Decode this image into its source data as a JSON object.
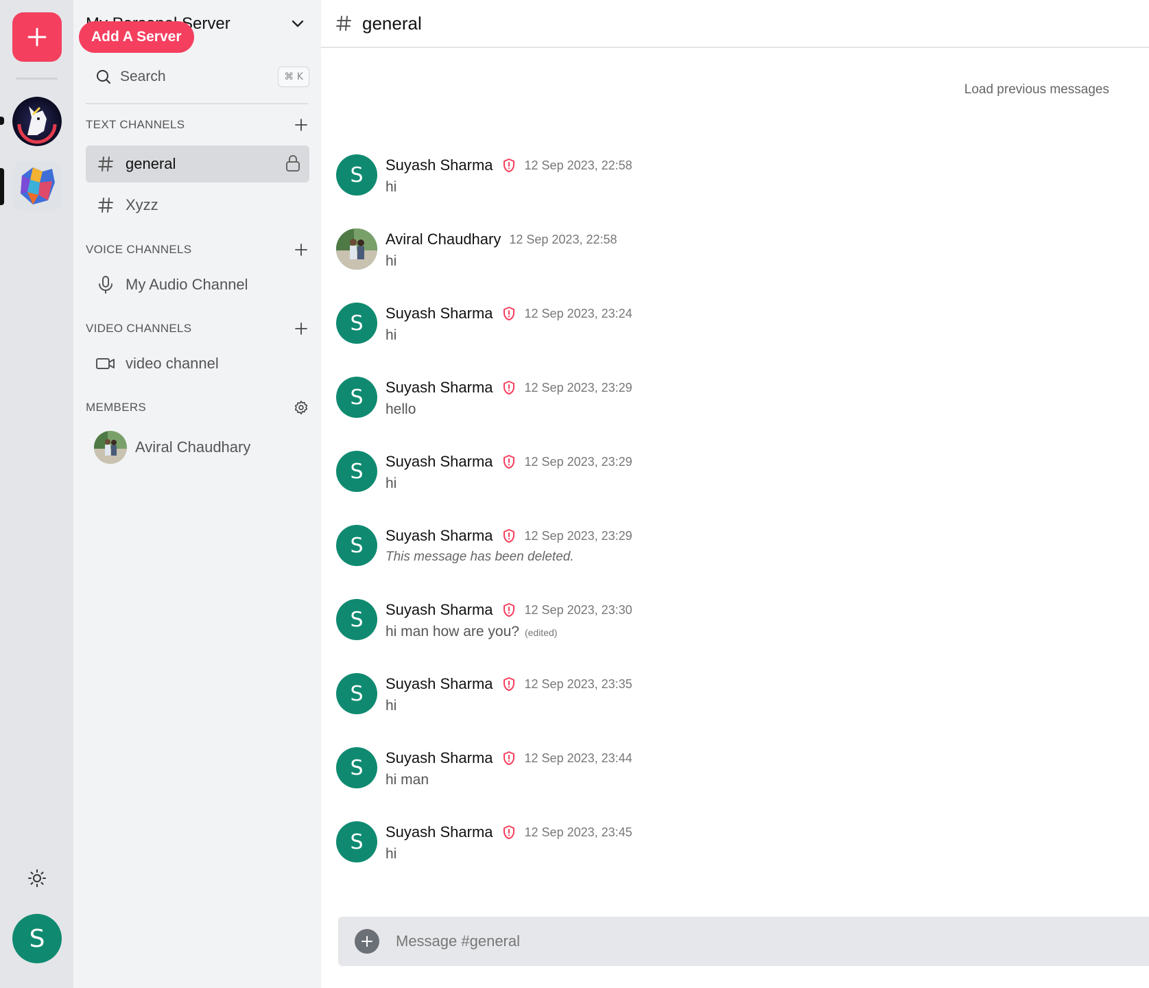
{
  "rail": {
    "add_server_tooltip": "Add A Server",
    "servers": [
      {
        "icon": "unicorn-logo-icon",
        "active": false
      },
      {
        "icon": "lion-logo-icon",
        "active": true
      }
    ],
    "user_avatar_letter": "S",
    "accent_color": "#f43f5e"
  },
  "sidebar": {
    "server_name": "My Personal Server",
    "search_label": "Search",
    "search_shortcut": "⌘ K",
    "sections": {
      "text": {
        "title": "TEXT CHANNELS"
      },
      "voice": {
        "title": "VOICE CHANNELS"
      },
      "video": {
        "title": "VIDEO CHANNELS"
      },
      "members": {
        "title": "MEMBERS"
      }
    },
    "text_channels": [
      {
        "name": "general",
        "active": true,
        "locked": true
      },
      {
        "name": "Xyzz",
        "active": false,
        "locked": false
      }
    ],
    "voice_channels": [
      {
        "name": "My Audio Channel"
      }
    ],
    "video_channels": [
      {
        "name": "video channel"
      }
    ],
    "members": [
      {
        "name": "Aviral Chaudhary"
      }
    ]
  },
  "chat": {
    "channel_name": "general",
    "load_previous": "Load previous messages",
    "composer_placeholder": "Message #general",
    "avatar_color": "#0f8a70",
    "messages": [
      {
        "author": "Suyash Sharma",
        "avatar_letter": "S",
        "moderator": true,
        "time": "12 Sep 2023, 22:58",
        "text": "hi"
      },
      {
        "author": "Aviral Chaudhary",
        "avatar_letter": "",
        "moderator": false,
        "time": "12 Sep 2023, 22:58",
        "text": "hi"
      },
      {
        "author": "Suyash Sharma",
        "avatar_letter": "S",
        "moderator": true,
        "time": "12 Sep 2023, 23:24",
        "text": "hi"
      },
      {
        "author": "Suyash Sharma",
        "avatar_letter": "S",
        "moderator": true,
        "time": "12 Sep 2023, 23:29",
        "text": "hello"
      },
      {
        "author": "Suyash Sharma",
        "avatar_letter": "S",
        "moderator": true,
        "time": "12 Sep 2023, 23:29",
        "text": "hi"
      },
      {
        "author": "Suyash Sharma",
        "avatar_letter": "S",
        "moderator": true,
        "time": "12 Sep 2023, 23:29",
        "text": "This message has been deleted.",
        "deleted": true
      },
      {
        "author": "Suyash Sharma",
        "avatar_letter": "S",
        "moderator": true,
        "time": "12 Sep 2023, 23:30",
        "text": "hi man how are you?",
        "edited": "(edited)"
      },
      {
        "author": "Suyash Sharma",
        "avatar_letter": "S",
        "moderator": true,
        "time": "12 Sep 2023, 23:35",
        "text": "hi"
      },
      {
        "author": "Suyash Sharma",
        "avatar_letter": "S",
        "moderator": true,
        "time": "12 Sep 2023, 23:44",
        "text": "hi man"
      },
      {
        "author": "Suyash Sharma",
        "avatar_letter": "S",
        "moderator": true,
        "time": "12 Sep 2023, 23:45",
        "text": "hi"
      }
    ]
  }
}
